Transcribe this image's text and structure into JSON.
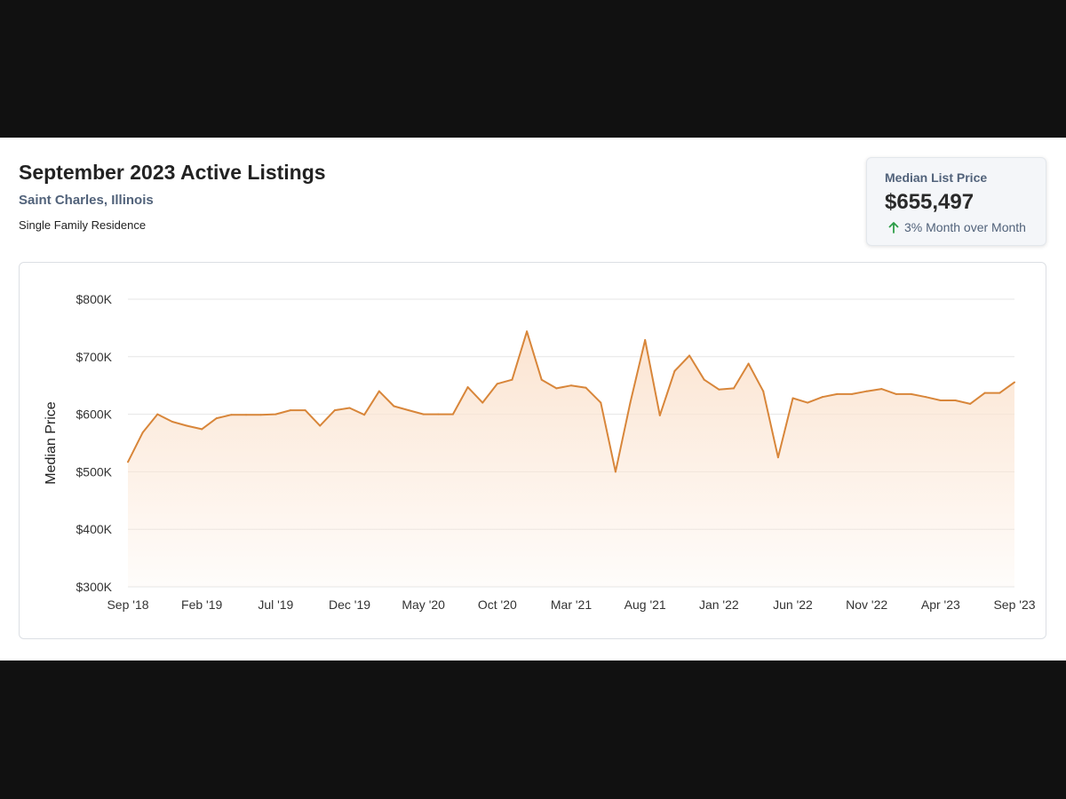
{
  "header": {
    "title": "September 2023 Active Listings",
    "location": "Saint Charles, Illinois",
    "property_type": "Single Family Residence"
  },
  "kpi": {
    "label": "Median List Price",
    "value": "$655,497",
    "change": "3% Month over Month",
    "change_icon": "arrow-up-icon",
    "change_color": "#2e9e49"
  },
  "colors": {
    "line": "#d8863a",
    "fill": "#fbe3cf",
    "grid": "#e6e6e6"
  },
  "chart_data": {
    "type": "area",
    "ylabel": "Median Price",
    "xlabel": "",
    "ylim": [
      300000,
      800000
    ],
    "y_ticks": [
      300000,
      400000,
      500000,
      600000,
      700000,
      800000
    ],
    "y_tick_labels": [
      "$300K",
      "$400K",
      "$500K",
      "$600K",
      "$700K",
      "$800K"
    ],
    "x_tick_labels": [
      "Sep '18",
      "Feb '19",
      "Jul '19",
      "Dec '19",
      "May '20",
      "Oct '20",
      "Mar '21",
      "Aug '21",
      "Jan '22",
      "Jun '22",
      "Nov '22",
      "Apr '23",
      "Sep '23"
    ],
    "x_tick_every": 5,
    "grid": true,
    "series": [
      {
        "values": [
          517000,
          568000,
          600000,
          587000,
          580000,
          574000,
          593000,
          599000,
          599000,
          599000,
          600000,
          607000,
          607000,
          580000,
          607000,
          611000,
          599000,
          640000,
          614000,
          607000,
          600000,
          600000,
          600000,
          647000,
          620000,
          653000,
          660000,
          744000,
          660000,
          645000,
          650000,
          646000,
          620000,
          500000,
          620000,
          729000,
          598000,
          675000,
          702000,
          660000,
          643000,
          645000,
          688000,
          640000,
          525000,
          628000,
          620000,
          630000,
          635000,
          635000,
          640000,
          644000,
          635000,
          635000,
          630000,
          624000,
          624000,
          618000,
          637000,
          637000,
          655497
        ]
      }
    ]
  }
}
